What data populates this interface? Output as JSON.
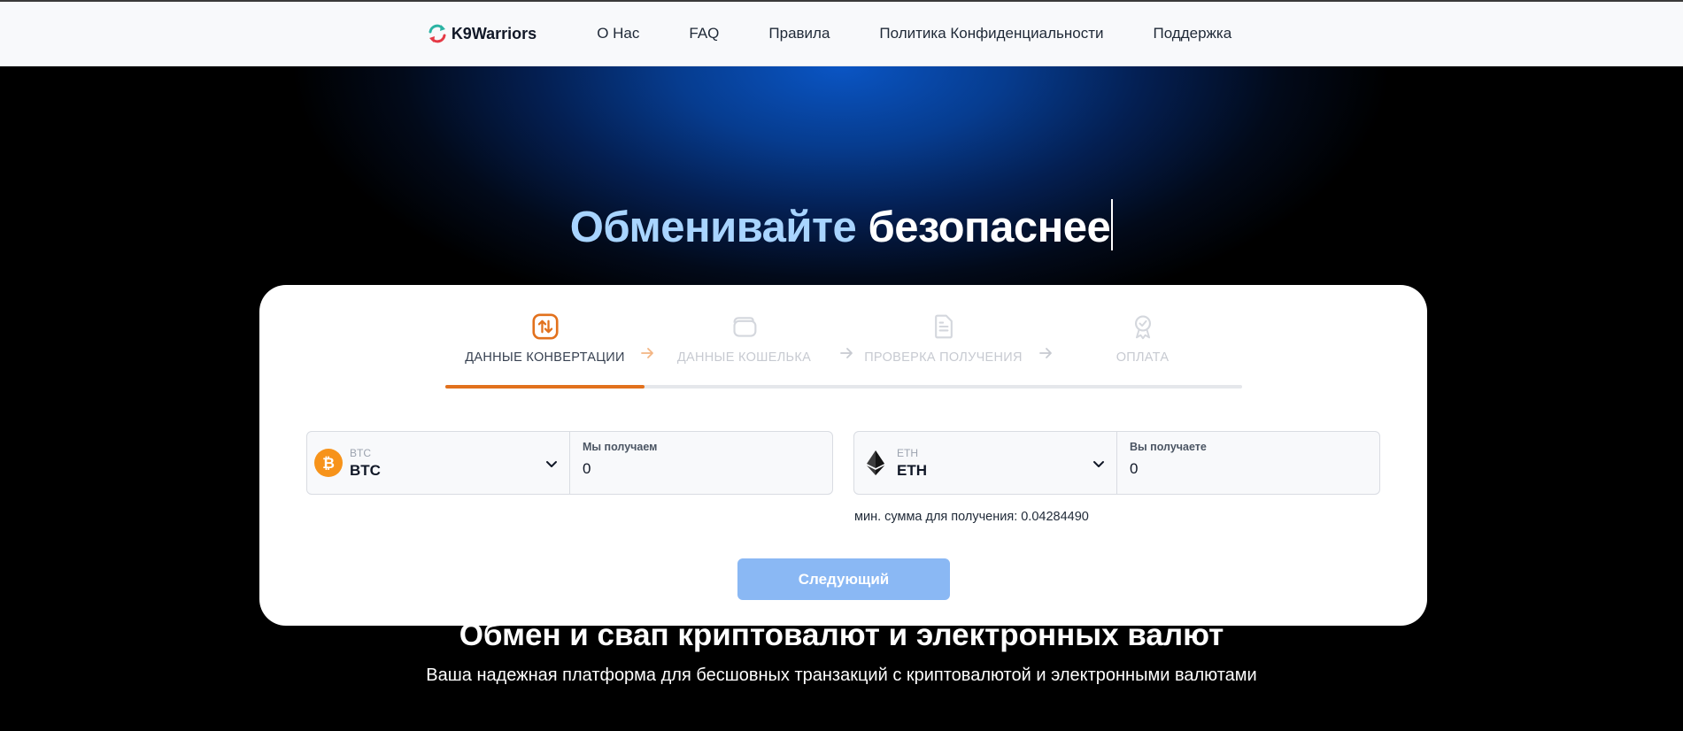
{
  "header": {
    "logo_text": "K9Warriors",
    "nav": [
      {
        "label": "О Нас"
      },
      {
        "label": "FAQ"
      },
      {
        "label": "Правила"
      },
      {
        "label": "Политика Конфиденциальности"
      },
      {
        "label": "Поддержка"
      }
    ]
  },
  "hero": {
    "title_part1": "Обменивайте",
    "title_part2": "безопаснее"
  },
  "steps": [
    {
      "label": "ДАННЫЕ КОНВЕРТАЦИИ",
      "icon": "exchange-arrows-icon",
      "active": true
    },
    {
      "label": "ДАННЫЕ КОШЕЛЬКА",
      "icon": "wallet-icon",
      "active": false
    },
    {
      "label": "ПРОВЕРКА ПОЛУЧЕНИЯ",
      "icon": "document-icon",
      "active": false
    },
    {
      "label": "ОПЛАТА",
      "icon": "award-badge-icon",
      "active": false
    }
  ],
  "progress": {
    "completed_steps": 1,
    "total_steps": 4
  },
  "from": {
    "currency_small": "BTC",
    "currency": "BTC",
    "amount_label": "Мы получаем",
    "amount_value": "0"
  },
  "to": {
    "currency_small": "ETH",
    "currency": "ETH",
    "amount_label": "Вы получаете",
    "amount_value": "0"
  },
  "min_note": "мин. сумма для получения: 0.04284490",
  "next_button": "Следующий",
  "section": {
    "title": "Обмен и свап криптовалют и электронных валют",
    "subtitle": "Ваша надежная платформа для бесшовных транзакций с криптовалютой и электронными валютами"
  },
  "colors": {
    "accent_orange": "#e2711d",
    "button_blue": "#8ab8f4",
    "title_light_blue": "#a8d4ff",
    "btc_orange": "#f7931a"
  }
}
